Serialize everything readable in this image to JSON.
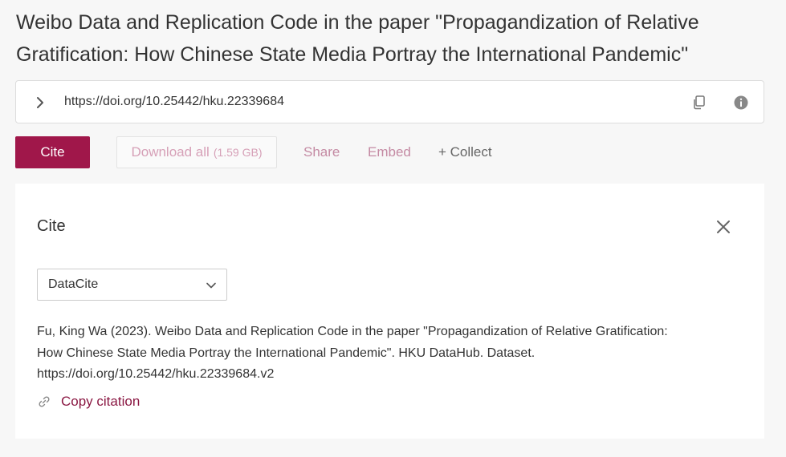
{
  "page": {
    "title": "Weibo Data and Replication Code in the paper \"Propagandization of Relative Gratification: How Chinese State Media Portray the International Pandemic\""
  },
  "doi_bar": {
    "url": "https://doi.org/10.25442/hku.22339684",
    "expand_icon": "chevron-right-icon",
    "copy_icon": "copy-icon",
    "info_icon": "info-icon"
  },
  "actions": {
    "cite_label": "Cite",
    "download_label": "Download all",
    "download_size": "(1.59 GB)",
    "share_label": "Share",
    "embed_label": "Embed",
    "collect_label": "+ Collect"
  },
  "cite_panel": {
    "title": "Cite",
    "close_icon": "close-icon",
    "format_selected": "DataCite",
    "citation": "Fu, King Wa (2023). Weibo Data and Replication Code in the paper \"Propagandization of Relative Gratification: How Chinese State Media Portray the International Pandemic\". HKU DataHub. Dataset. https://doi.org/10.25442/hku.22339684.v2",
    "copy_label": "Copy citation",
    "copy_icon": "link-icon"
  },
  "colors": {
    "accent": "#a0174a",
    "background": "#f7f7f7",
    "panel": "#ffffff",
    "muted_link": "#c48aa3"
  }
}
